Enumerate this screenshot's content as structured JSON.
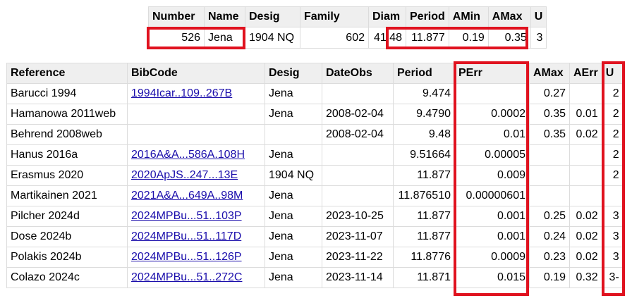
{
  "top": {
    "headers": [
      "Number",
      "Name",
      "Desig",
      "Family",
      "Diam",
      "Period",
      "AMin",
      "AMax",
      "U"
    ],
    "row": [
      "526",
      "Jena",
      "1904 NQ",
      "602",
      "41.48",
      "11.877",
      "0.19",
      "0.35",
      "3"
    ]
  },
  "main": {
    "headers": [
      "Reference",
      "BibCode",
      "Desig",
      "DateObs",
      "Period",
      "PErr",
      "AMax",
      "AErr",
      "U"
    ],
    "rows": [
      [
        "Barucci 1994",
        "1994Icar..109..267B",
        "Jena",
        "",
        "9.474",
        "",
        "0.27",
        "",
        "2"
      ],
      [
        "Hamanowa 2011web",
        "",
        "Jena",
        "2008-02-04",
        "9.4790",
        "0.0002",
        "0.35",
        "0.01",
        "2"
      ],
      [
        "Behrend 2008web",
        "",
        "",
        "2008-02-04",
        "9.48",
        "0.01",
        "0.35",
        "0.02",
        "2"
      ],
      [
        "Hanus 2016a",
        "2016A&A...586A.108H",
        "Jena",
        "",
        "9.51664",
        "0.00005",
        "",
        "",
        "2"
      ],
      [
        "Erasmus 2020",
        "2020ApJS..247...13E",
        "1904 NQ",
        "",
        "11.877",
        "0.009",
        "",
        "",
        "2"
      ],
      [
        "Martikainen 2021",
        "2021A&A...649A..98M",
        "Jena",
        "",
        "11.876510",
        "0.00000601",
        "",
        "",
        ""
      ],
      [
        "Pilcher 2024d",
        "2024MPBu...51..103P",
        "Jena",
        "2023-10-25",
        "11.877",
        "0.001",
        "0.25",
        "0.02",
        "3"
      ],
      [
        "Dose 2024b",
        "2024MPBu...51..117D",
        "Jena",
        "2023-11-07",
        "11.877",
        "0.001",
        "0.24",
        "0.02",
        "3"
      ],
      [
        "Polakis 2024b",
        "2024MPBu...51..126P",
        "Jena",
        "2023-11-22",
        "11.8776",
        "0.0009",
        "0.23",
        "0.02",
        "3"
      ],
      [
        "Colazo 2024c",
        "2024MPBu...51..272C",
        "Jena",
        "2023-11-14",
        "11.871",
        "0.015",
        "0.19",
        "0.32",
        "3-"
      ]
    ]
  }
}
